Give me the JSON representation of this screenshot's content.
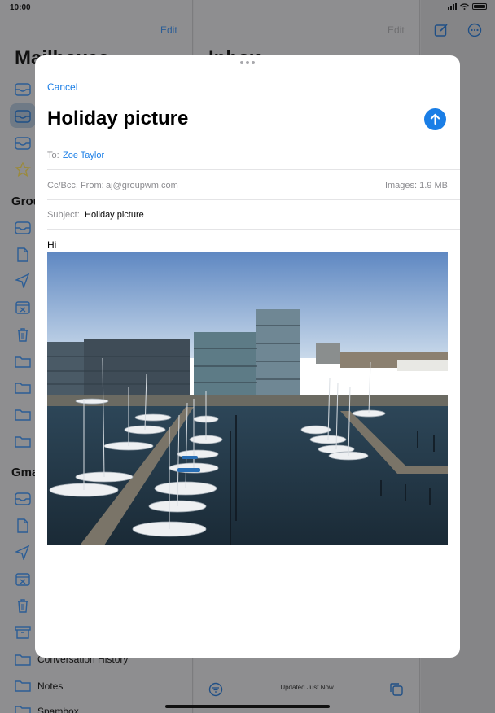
{
  "status_bar": {
    "time": "10:00"
  },
  "background": {
    "sidebar": {
      "edit_label": "Edit",
      "title": "Mailboxes",
      "sections": [
        {
          "name": "Group"
        },
        {
          "name": "Gmail"
        }
      ],
      "visible_labels": [
        "Conversation History",
        "Notes",
        "Spambox"
      ]
    },
    "list": {
      "edit_label": "Edit",
      "title": "Inbox",
      "updated": "Updated Just Now"
    }
  },
  "compose": {
    "cancel_label": "Cancel",
    "title": "Holiday picture",
    "to_label": "To:",
    "to_value": "Zoe Taylor",
    "cc_label": "Cc/Bcc, From:",
    "cc_value": "aj@groupwm.com",
    "images_label": "Images:",
    "images_value": "1.9 MB",
    "subject_label": "Subject:",
    "subject_value": "Holiday picture",
    "body": "Hi"
  },
  "colors": {
    "accent": "#1a7ee6",
    "label_gray": "#8c8c90",
    "dim_background": "#8e8e90"
  }
}
